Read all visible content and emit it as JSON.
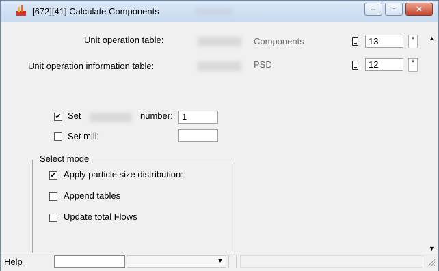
{
  "window": {
    "title": "[672][41]  Calculate Components",
    "minimize_glyph": "‒",
    "maximize_glyph": "▫",
    "close_glyph": "✕"
  },
  "rows": {
    "unit_op_label": "Unit operation table:",
    "unit_op_value": "Components",
    "unit_op_number": "13",
    "unit_op_info_label": "Unit operation information table:",
    "unit_op_info_value": "PSD",
    "unit_op_info_number": "12",
    "star_glyph": "*"
  },
  "settings": {
    "set_label": "Set",
    "number_label": "number:",
    "number_value": "1",
    "set_checked": true,
    "set_mill_label": "Set mill:",
    "set_mill_checked": false,
    "set_mill_value": ""
  },
  "select_mode": {
    "title": "Select mode",
    "apply_psd_label": "Apply particle size distribution:",
    "apply_psd_checked": true,
    "append_tables_label": "Append tables",
    "append_tables_checked": false,
    "update_flows_label": "Update total Flows",
    "update_flows_checked": false
  },
  "statusbar": {
    "help_label": "Help",
    "dropdown_glyph": "▼"
  },
  "icons": {
    "check_glyph": "✔",
    "scroll_up": "▲",
    "scroll_down": "▼"
  },
  "colors": {
    "title_bg": "#c8daf0",
    "close_button": "#c5432a",
    "window_bg": "#f0f0f0"
  }
}
